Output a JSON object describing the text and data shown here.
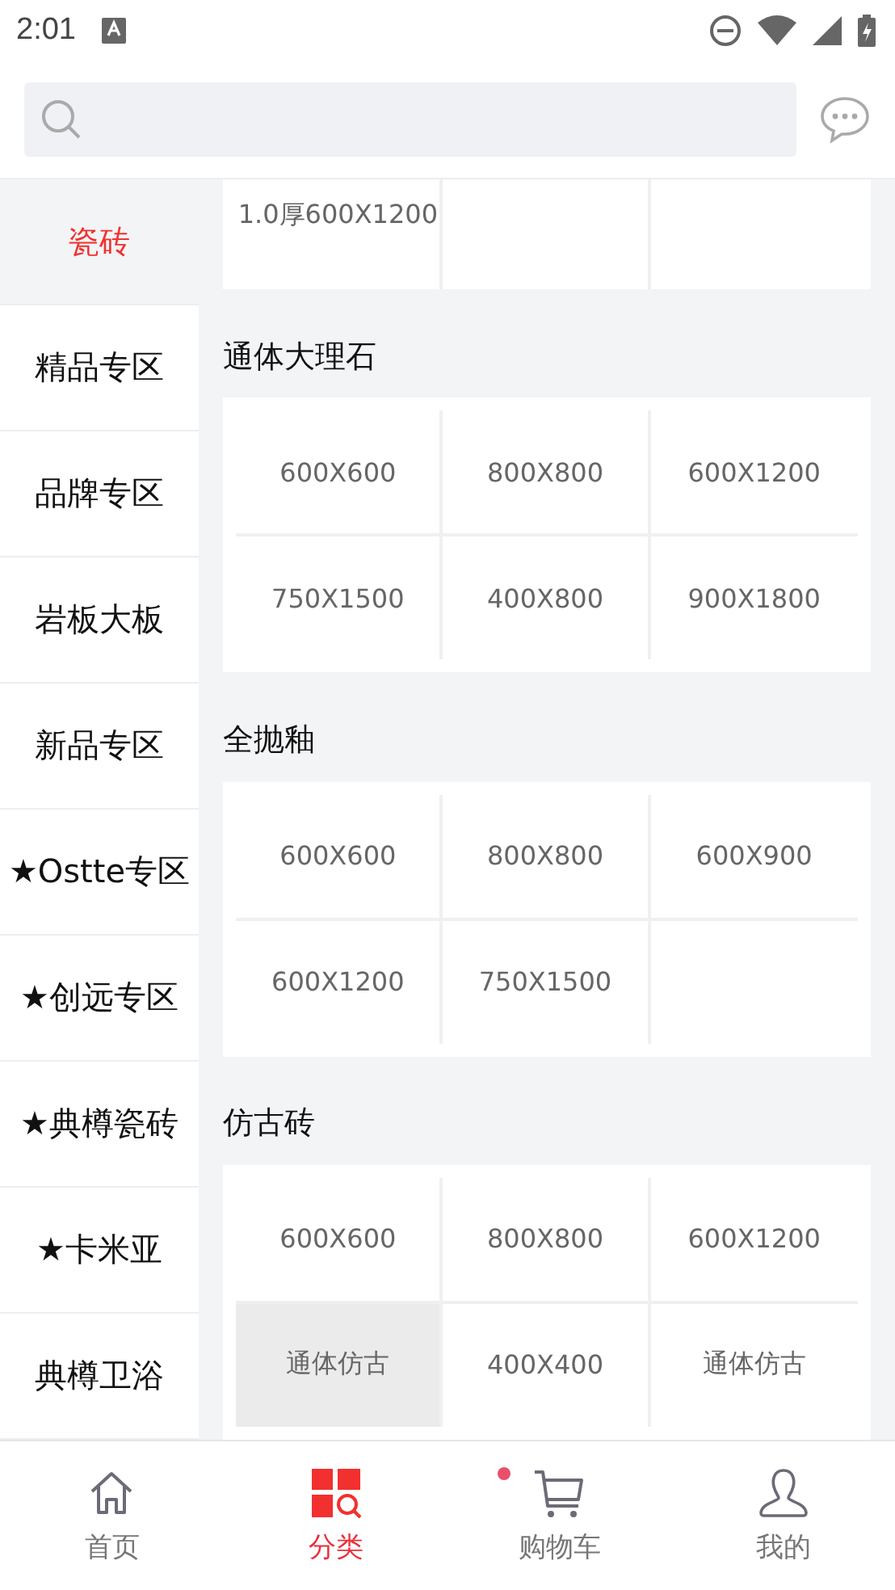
{
  "status_bar": {
    "time": "2:01"
  },
  "sidebar": {
    "items": [
      {
        "label": "瓷砖",
        "selected": true
      },
      {
        "label": "精品专区",
        "selected": false
      },
      {
        "label": "品牌专区",
        "selected": false
      },
      {
        "label": "岩板大板",
        "selected": false
      },
      {
        "label": "新品专区",
        "selected": false
      },
      {
        "label": "★Ostte专区",
        "selected": false
      },
      {
        "label": "★创远专区",
        "selected": false
      },
      {
        "label": "★典樽瓷砖",
        "selected": false
      },
      {
        "label": "★卡米亚",
        "selected": false
      },
      {
        "label": "典樽卫浴",
        "selected": false
      }
    ]
  },
  "sections": [
    {
      "cells": [
        {
          "label": "1.0厚600X1200",
          "selected": false
        }
      ]
    },
    {
      "title": "通体大理石",
      "cells": [
        {
          "label": "600X600",
          "selected": false
        },
        {
          "label": "800X800",
          "selected": false
        },
        {
          "label": "600X1200",
          "selected": false
        },
        {
          "label": "750X1500",
          "selected": false
        },
        {
          "label": "400X800",
          "selected": false
        },
        {
          "label": "900X1800",
          "selected": false
        }
      ]
    },
    {
      "title": "全抛釉",
      "cells": [
        {
          "label": "600X600",
          "selected": false
        },
        {
          "label": "800X800",
          "selected": false
        },
        {
          "label": "600X900",
          "selected": false
        },
        {
          "label": "600X1200",
          "selected": false
        },
        {
          "label": "750X1500",
          "selected": false
        }
      ]
    },
    {
      "title": "仿古砖",
      "cells": [
        {
          "label": "600X600",
          "selected": false
        },
        {
          "label": "800X800",
          "selected": false
        },
        {
          "label": "600X1200",
          "selected": false
        },
        {
          "label": "通体仿古",
          "selected": true
        },
        {
          "label": "400X400",
          "selected": false
        },
        {
          "label": "通体仿古",
          "selected": false
        }
      ]
    }
  ],
  "tab_bar": {
    "items": [
      {
        "kind": "home",
        "label": "首页",
        "selected": false,
        "badge": false
      },
      {
        "kind": "category",
        "label": "分类",
        "selected": true,
        "badge": false
      },
      {
        "kind": "cart",
        "label": "购物车",
        "selected": false,
        "badge": true
      },
      {
        "kind": "profile",
        "label": "我的",
        "selected": false,
        "badge": false
      }
    ]
  }
}
